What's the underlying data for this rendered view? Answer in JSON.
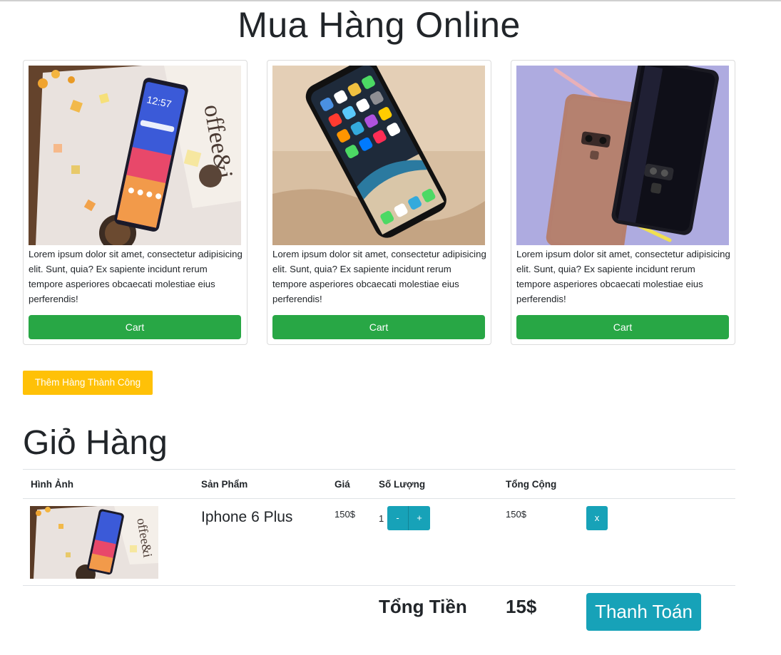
{
  "page": {
    "title": "Mua Hàng Online"
  },
  "products": [
    {
      "image": "oppo-phone-on-magazine",
      "description": "Lorem ipsum dolor sit amet, consectetur adipisicing elit. Sunt, quia? Ex sapiente incidunt rerum tempore asperiores obcaecati molestiae eius perferendis!",
      "cart_label": "Cart"
    },
    {
      "image": "iphone-x-on-wood",
      "description": "Lorem ipsum dolor sit amet, consectetur adipisicing elit. Sunt, quia? Ex sapiente incidunt rerum tempore asperiores obcaecati molestiae eius perferendis!",
      "cart_label": "Cart"
    },
    {
      "image": "samsung-note9-on-purple",
      "description": "Lorem ipsum dolor sit amet, consectetur adipisicing elit. Sunt, quia? Ex sapiente incidunt rerum tempore asperiores obcaecati molestiae eius perferendis!",
      "cart_label": "Cart"
    }
  ],
  "alert": {
    "label": "Thêm Hàng Thành Công"
  },
  "cart": {
    "title": "Giỏ Hàng",
    "columns": [
      "Hình Ảnh",
      "Sản Phẩm",
      "Giá",
      "Số Lượng",
      "Tổng Cộng"
    ],
    "rows": [
      {
        "image": "oppo-phone-on-magazine",
        "name": "Iphone 6 Plus",
        "price": "150$",
        "quantity": "1",
        "minus_label": "-",
        "plus_label": "+",
        "line_total": "150$",
        "remove_label": "x"
      }
    ],
    "total_label": "Tổng Tiền",
    "total_value": "15$",
    "checkout_label": "Thanh Toán"
  },
  "colors": {
    "success": "#28a745",
    "warning": "#ffc107",
    "info": "#17a2b8"
  }
}
